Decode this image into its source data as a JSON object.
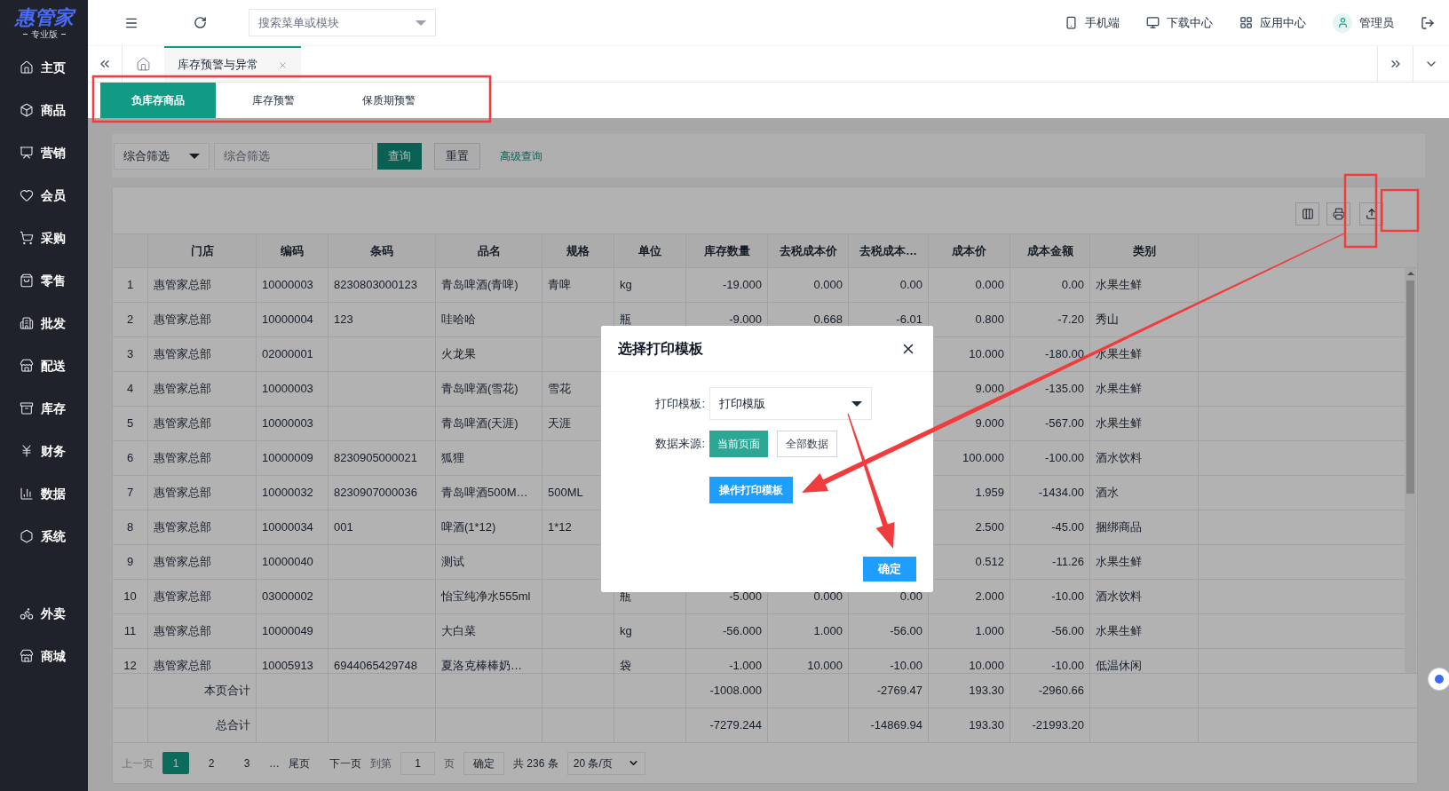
{
  "logo": {
    "name": "惠管家",
    "edition": "专业版"
  },
  "sidebar": {
    "items": [
      {
        "label": "主页",
        "kind": "home"
      },
      {
        "label": "商品",
        "kind": "box"
      },
      {
        "label": "营销",
        "kind": "chart"
      },
      {
        "label": "会员",
        "kind": "heart"
      },
      {
        "label": "采购",
        "kind": "cart"
      },
      {
        "label": "零售",
        "kind": "bag"
      },
      {
        "label": "批发",
        "kind": "building"
      },
      {
        "label": "配送",
        "kind": "store"
      },
      {
        "label": "库存",
        "kind": "archive"
      },
      {
        "label": "财务",
        "kind": "yen"
      },
      {
        "label": "数据",
        "kind": "bars"
      },
      {
        "label": "系统",
        "kind": "hexagon"
      }
    ],
    "extra_items": [
      {
        "label": "外卖",
        "kind": "bike"
      },
      {
        "label": "商城",
        "kind": "store"
      }
    ]
  },
  "header": {
    "search": {
      "placeholder": "搜索菜单或模块"
    },
    "links": [
      {
        "label": "手机端",
        "kind": "phone"
      },
      {
        "label": "下载中心",
        "kind": "monitor"
      },
      {
        "label": "应用中心",
        "kind": "apps"
      },
      {
        "label": "管理员",
        "kind": "user"
      }
    ]
  },
  "page_tabs": [
    {
      "label": "库存预警与异常",
      "selected": true
    }
  ],
  "sub_tabs": [
    {
      "label": "负库存商品",
      "selected": true
    },
    {
      "label": "库存预警",
      "selected": false
    },
    {
      "label": "保质期预警",
      "selected": false
    }
  ],
  "filter": {
    "select": "综合筛选",
    "placeholder": "综合筛选",
    "buttons": [
      {
        "label": "查询",
        "kind": "primary"
      },
      {
        "label": "重置",
        "kind": "plain"
      }
    ],
    "link": "高级查询"
  },
  "table": {
    "columns": [
      "门店",
      "编码",
      "条码",
      "品名",
      "规格",
      "单位",
      "库存数量",
      "去税成本价",
      "去税成本…",
      "成本价",
      "成本金额",
      "类别"
    ],
    "rows": [
      {
        "index": "1",
        "store": "惠管家总部",
        "code": "10000003",
        "barcode": "8230803000123",
        "name": "青岛啤酒(青啤)",
        "spec": "青啤",
        "unit": "kg",
        "stock_qty": "-19.000",
        "net_cost_price": "0.000",
        "net_cost_total": "0.00",
        "cost_price": "0.000",
        "cost_amount": "0.00",
        "category": "水果生鲜"
      },
      {
        "index": "2",
        "store": "惠管家总部",
        "code": "10000004",
        "barcode": "123",
        "name": "哇哈哈",
        "unit": "瓶",
        "stock_qty": "-9.000",
        "net_cost_price": "0.668",
        "net_cost_total": "-6.01",
        "cost_price": "0.800",
        "cost_amount": "-7.20",
        "category": "秀山"
      },
      {
        "index": "3",
        "store": "惠管家总部",
        "code": "02000001",
        "name": "火龙果",
        "cost_price": "10.000",
        "cost_amount": "-180.00",
        "category": "水果生鲜"
      },
      {
        "index": "4",
        "store": "惠管家总部",
        "code": "10000003",
        "name": "青岛啤酒(雪花)",
        "spec": "雪花",
        "cost_price": "9.000",
        "cost_amount": "-135.00",
        "category": "水果生鲜"
      },
      {
        "index": "5",
        "store": "惠管家总部",
        "code": "10000003",
        "name": "青岛啤酒(天涯)",
        "spec": "天涯",
        "cost_price": "9.000",
        "cost_amount": "-567.00",
        "category": "水果生鲜"
      },
      {
        "index": "6",
        "store": "惠管家总部",
        "code": "10000009",
        "barcode": "8230905000021",
        "name": "狐狸",
        "cost_price": "100.000",
        "cost_amount": "-100.00",
        "category": "酒水饮料"
      },
      {
        "index": "7",
        "store": "惠管家总部",
        "code": "10000032",
        "barcode": "8230907000036",
        "name": "青岛啤酒500M…",
        "spec": "500ML",
        "cost_price": "1.959",
        "cost_amount": "-1434.00",
        "category": "酒水"
      },
      {
        "index": "8",
        "store": "惠管家总部",
        "code": "10000034",
        "barcode": "001",
        "name": "啤酒(1*12)",
        "spec": "1*12",
        "cost_price": "2.500",
        "cost_amount": "-45.00",
        "category": "捆绑商品"
      },
      {
        "index": "9",
        "store": "惠管家总部",
        "code": "10000040",
        "name": "测试",
        "cost_price": "0.512",
        "cost_amount": "-11.26",
        "category": "水果生鲜"
      },
      {
        "index": "10",
        "store": "惠管家总部",
        "code": "03000002",
        "name": "怡宝纯净水555ml",
        "unit": "瓶",
        "stock_qty": "-5.000",
        "net_cost_price": "0.000",
        "net_cost_total": "0.00",
        "cost_price": "2.000",
        "cost_amount": "-10.00",
        "category": "酒水饮料"
      },
      {
        "index": "11",
        "store": "惠管家总部",
        "code": "10000049",
        "name": "大白菜",
        "unit": "kg",
        "stock_qty": "-56.000",
        "net_cost_price": "1.000",
        "net_cost_total": "-56.00",
        "cost_price": "1.000",
        "cost_amount": "-56.00",
        "category": "水果生鲜"
      },
      {
        "index": "12",
        "store": "惠管家总部",
        "code": "10005913",
        "barcode": "6944065429748",
        "name": "夏洛克棒棒奶…",
        "unit": "袋",
        "stock_qty": "-1.000",
        "net_cost_price": "10.000",
        "net_cost_total": "-10.00",
        "cost_price": "10.000",
        "cost_amount": "-10.00",
        "category": "低温休闲"
      }
    ],
    "summary": [
      {
        "store": "本页合计",
        "stock_qty": "-1008.000",
        "net_cost_total": "-2769.47",
        "cost_price": "193.30",
        "cost_amount": "-2960.66"
      },
      {
        "store": "总合计",
        "stock_qty": "-7279.244",
        "net_cost_total": "-14869.94",
        "cost_price": "193.30",
        "cost_amount": "-21993.20"
      }
    ]
  },
  "pagination": {
    "prev": {
      "label": "上一页",
      "disabled": true
    },
    "pages": [
      {
        "label": "1",
        "selected": true
      },
      {
        "label": "2",
        "selected": false
      },
      {
        "label": "3",
        "selected": false
      }
    ],
    "ellipsis": "…",
    "last": "尾页",
    "next": "下一页",
    "goto_label": "到第",
    "goto_value": "1",
    "page_unit": "页",
    "confirm": "确定",
    "total": "共 236 条",
    "page_size": "20 条/页"
  },
  "dialog": {
    "title": "选择打印模板",
    "template_label": "打印模板:",
    "template_value": "打印模版",
    "source_label": "数据来源:",
    "sources": [
      {
        "label": "当前页面",
        "selected": true
      },
      {
        "label": "全部数据",
        "selected": false
      }
    ],
    "edit_button": "操作打印模板",
    "ok_button": "确定"
  }
}
